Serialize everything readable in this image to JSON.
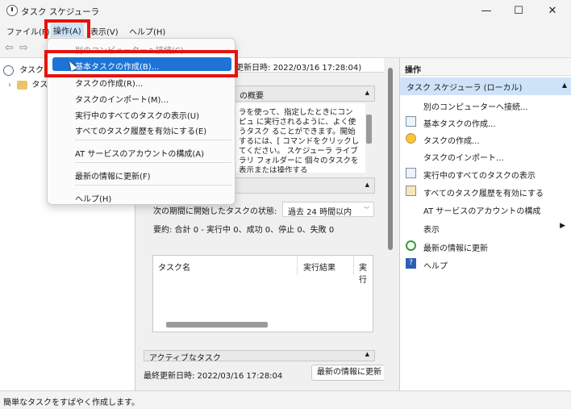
{
  "window": {
    "title": "タスク スケジューラ",
    "minimize": "—",
    "maximize": "☐",
    "close": "✕"
  },
  "menubar": {
    "file": "ファイル(F)",
    "action": "操作(A)",
    "view": "表示(V)",
    "help": "ヘルプ(H)"
  },
  "toolbar": {
    "back": "⇦",
    "forward": "⇨"
  },
  "tree": {
    "root": "タスク",
    "child": "タス"
  },
  "center": {
    "last_refresh_header": "更新日時: 2022/03/16 17:28:04)",
    "overview_title": "の概要",
    "overview_text": "ラを使って、指定したときにコンピュ に実行されるように、よく使うタスク ることができます。開始するには、[ コマンドをクリックしてください。 スケジューラ ライブラリ フォルダーに 個々のタスクを表示または操作する",
    "status_label": "次の期間に開始したタスクの状態:",
    "period_select": "過去 24 時間以内",
    "summary": "要約: 合計 0 - 実行中 0、成功 0、停止 0、失敗 0",
    "table_headers": [
      "タスク名",
      "実行結果",
      "実行"
    ],
    "active_tasks": "アクティブなタスク",
    "footer_refresh": "最終更新日時: 2022/03/16 17:28:04",
    "refresh_button": "最新の情報に更新"
  },
  "actions": {
    "header": "操作",
    "group": "タスク スケジューラ (ローカル)",
    "items": [
      {
        "label": "別のコンピューターへ接続...",
        "icon": "none"
      },
      {
        "label": "基本タスクの作成...",
        "icon": "calendar-icon"
      },
      {
        "label": "タスクの作成...",
        "icon": "clock-icon"
      },
      {
        "label": "タスクのインポート...",
        "icon": "none"
      },
      {
        "label": "実行中のすべてのタスクの表示",
        "icon": "list-icon"
      },
      {
        "label": "すべてのタスク履歴を有効にする",
        "icon": "history-icon"
      },
      {
        "label": "AT サービスのアカウントの構成",
        "icon": "none"
      },
      {
        "label": "表示",
        "icon": "none"
      },
      {
        "label": "最新の情報に更新",
        "icon": "refresh-icon"
      },
      {
        "label": "ヘルプ",
        "icon": "help-icon"
      }
    ]
  },
  "dropdown": {
    "items": [
      "別のコンピューターへ接続(C)...",
      "基本タスクの作成(B)...",
      "タスクの作成(R)...",
      "タスクのインポート(M)...",
      "実行中のすべてのタスクの表示(U)",
      "すべてのタスク履歴を有効にする(E)",
      "AT サービスのアカウントの構成(A)",
      "最新の情報に更新(F)",
      "ヘルプ(H)"
    ]
  },
  "statusbar": {
    "text": "簡単なタスクをすばやく作成します。"
  },
  "colors": {
    "highlight_box": "#e8120c",
    "menu_selection": "#1e74d6",
    "actions_group": "#cfe3f8"
  }
}
